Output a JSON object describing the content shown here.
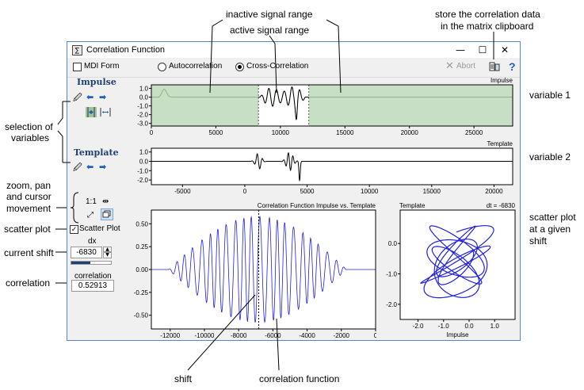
{
  "annotations": {
    "inactive_range": "inactive signal range",
    "active_range": "active signal range",
    "store_line1": "store the correlation data",
    "store_line2": "in the matrix clipboard",
    "variable1": "variable 1",
    "variable2": "variable 2",
    "selection_line1": "selection of",
    "selection_line2": "variables",
    "zoom_line1": "zoom, pan",
    "zoom_line2": "and cursor",
    "zoom_line3": "movement",
    "scatter_plot": "scatter plot",
    "current_shift": "current shift",
    "correlation": "correlation",
    "scatter_given_line1": "scatter plot",
    "scatter_given_line2": "at a given",
    "scatter_given_line3": "shift",
    "shift": "shift",
    "correlation_function": "correlation function"
  },
  "window": {
    "title": "Correlation Function",
    "minimize_glyph": "—",
    "maximize_glyph": "☐",
    "close_glyph": "✕"
  },
  "toolbar": {
    "mdi_form": "MDI Form",
    "mdi_checked": false,
    "autocorrelation": "Autocorrelation",
    "cross_correlation": "Cross-Correlation",
    "selected_mode": "Cross-Correlation",
    "abort": "Abort",
    "help": "?"
  },
  "left_panel": {
    "impulse_heading": "Impulse",
    "template_heading": "Template",
    "zoom_label": "1:1",
    "scatter_plot_label": "Scatter Plot",
    "scatter_plot_checked": true,
    "dx_label": "dx",
    "dx_value": "-6830",
    "shift_progress": 0.48,
    "correlation_label": "correlation",
    "correlation_value": "0.52913"
  },
  "colors": {
    "inactive_fill": "#c7dfc4",
    "curve": "#2020e0",
    "heading": "#1f3f77",
    "accent_blue": "#1f5fbf"
  },
  "chart_data": [
    {
      "type": "line",
      "title": "Impulse",
      "x_ticks": [
        "0",
        "5000",
        "10000",
        "15000",
        "20000",
        "25000"
      ],
      "y_ticks": [
        "1.0",
        "0.0",
        "-1.0",
        "-2.0",
        "-3.0"
      ],
      "xlim": [
        0,
        28000
      ],
      "ylim": [
        -3.3,
        1.4
      ],
      "active_range": [
        8300,
        12200
      ]
    },
    {
      "type": "line",
      "title": "Template",
      "x_ticks": [
        "-5000",
        "0",
        "5000",
        "10000",
        "15000",
        "20000"
      ],
      "y_ticks": [
        "1.0",
        "0.0",
        "-1.0",
        "-2.0"
      ],
      "xlim": [
        -7500,
        21500
      ],
      "ylim": [
        -2.5,
        1.4
      ]
    },
    {
      "type": "line",
      "title": "Correlation Function Impulse vs. Template",
      "x_ticks": [
        "-12000",
        "-10000",
        "-8000",
        "-6000",
        "-4000",
        "-2000",
        "0"
      ],
      "y_ticks": [
        "0.50",
        "0.25",
        "0.00",
        "-0.25",
        "-0.50"
      ],
      "xlim": [
        -13100,
        0
      ],
      "ylim": [
        -0.65,
        0.65
      ],
      "shift": -6830
    },
    {
      "type": "scatter",
      "title": "dt = -6830",
      "xlabel": "Impulse",
      "ylabel": "Template",
      "x_ticks": [
        "-2.0",
        "-1.0",
        "0.0",
        "1.0"
      ],
      "y_ticks": [
        "0.0",
        "-1.0",
        "-2.0"
      ],
      "xlim": [
        -2.7,
        1.8
      ],
      "ylim": [
        -2.5,
        1.1
      ]
    }
  ]
}
